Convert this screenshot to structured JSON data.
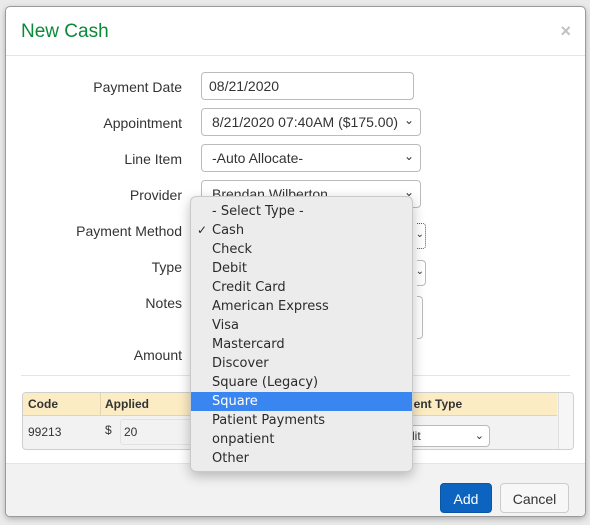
{
  "modal": {
    "title": "New Cash",
    "close_icon": "close-x-icon"
  },
  "form": {
    "payment_date": {
      "label": "Payment Date",
      "value": "08/21/2020"
    },
    "appointment": {
      "label": "Appointment",
      "value": "8/21/2020 07:40AM ($175.00)"
    },
    "line_item": {
      "label": "Line Item",
      "value": "-Auto Allocate-"
    },
    "provider": {
      "label": "Provider",
      "value": "Brendan Wilberton"
    },
    "payment_method": {
      "label": "Payment Method",
      "value": "Cash"
    },
    "type": {
      "label": "Type"
    },
    "notes": {
      "label": "Notes",
      "value": ""
    },
    "amount": {
      "label": "Amount"
    }
  },
  "dropdown": {
    "selected": "Cash",
    "highlighted": "Square",
    "options": [
      "- Select Type -",
      "Cash",
      "Check",
      "Debit",
      "Credit Card",
      "American Express",
      "Visa",
      "Mastercard",
      "Discover",
      "Square (Legacy)",
      "Square",
      "Patient Payments",
      "onpatient",
      "Other"
    ]
  },
  "table": {
    "headers": [
      "Code",
      "Applied",
      "Payment Type"
    ],
    "header_visible_fragment": "ment Type",
    "rows": [
      {
        "code": "99213",
        "currency": "$",
        "applied": "20",
        "payment_type": "Credit",
        "payment_type_visible": "dit"
      }
    ]
  },
  "footer": {
    "add_label": "Add",
    "cancel_label": "Cancel"
  },
  "colors": {
    "title": "#0a8a3a",
    "primary": "#0c64c0",
    "highlight": "#3a86f0",
    "table_header": "#fcecc4"
  }
}
